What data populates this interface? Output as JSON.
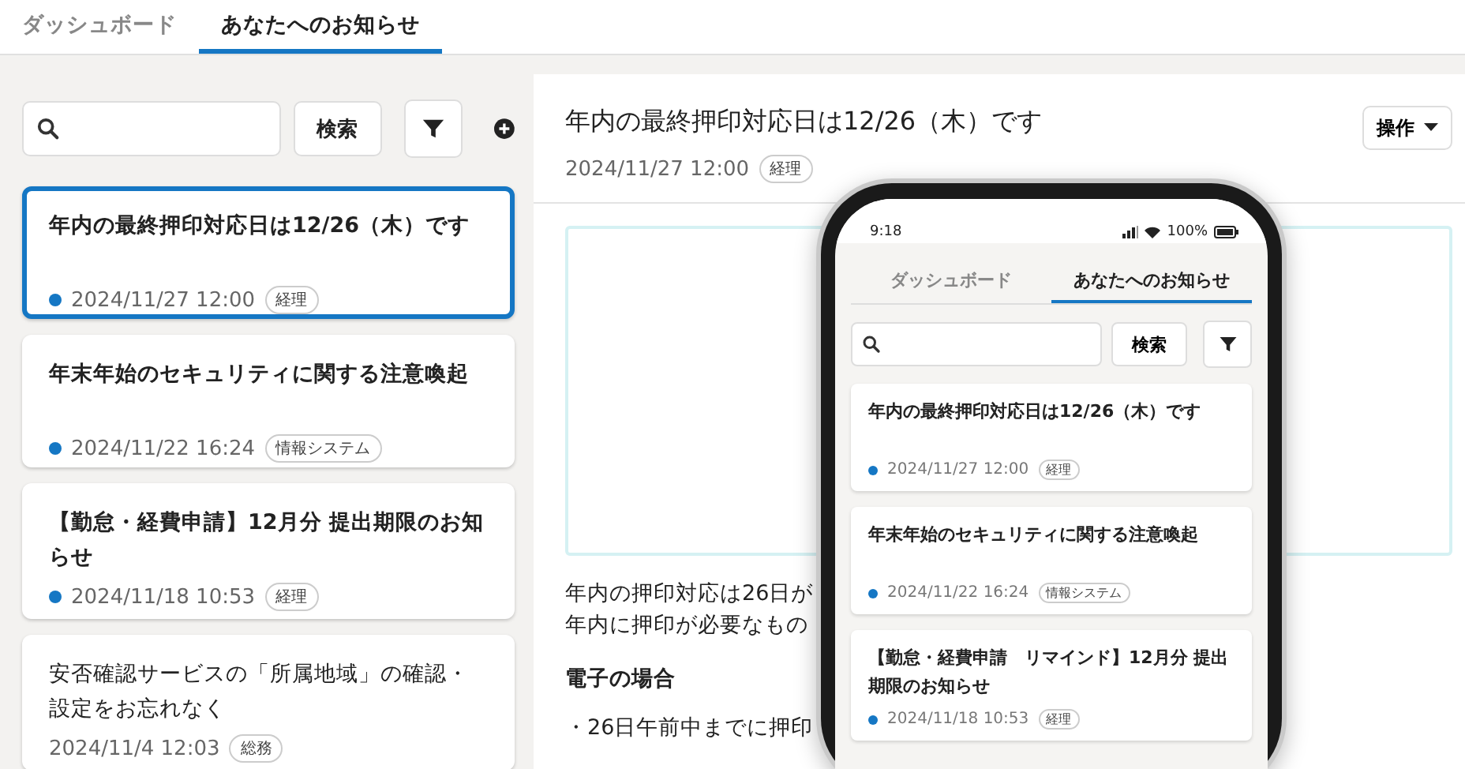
{
  "tabs": [
    {
      "label": "ダッシュボード",
      "selected": false
    },
    {
      "label": "あなたへのお知らせ",
      "selected": true
    }
  ],
  "sidebar": {
    "search": {
      "button": "検索"
    },
    "notices": [
      {
        "title": "年内の最終押印対応日は12/26（木）です",
        "date": "2024/11/27 12:00",
        "tag": "経理",
        "unread": true,
        "selected": true
      },
      {
        "title": "年末年始のセキュリティに関する注意喚起",
        "date": "2024/11/22 16:24",
        "tag": "情報システム",
        "unread": true,
        "selected": false
      },
      {
        "title": "【勤怠・経費申請】12月分 提出期限のお知らせ",
        "date": "2024/11/18 10:53",
        "tag": "経理",
        "unread": true,
        "selected": false
      },
      {
        "title": "安否確認サービスの「所属地域」の確認・設定をお忘れなく",
        "date": "2024/11/4 12:03",
        "tag": "総務",
        "unread": false,
        "selected": false
      }
    ]
  },
  "detail": {
    "title": "年内の最終押印対応日は12/26（木）です",
    "date": "2024/11/27 12:00",
    "tag": "経理",
    "action_button": "操作",
    "paragraphs": [
      "年内の押印対応は26日が",
      "年内に押印が必要なもの"
    ],
    "heading": "電子の場合",
    "bullet": "・26日午前中までに押印"
  },
  "phone": {
    "status_bar": {
      "time": "9:18",
      "battery": "100%"
    },
    "tabs": [
      {
        "label": "ダッシュボード",
        "selected": false
      },
      {
        "label": "あなたへのお知らせ",
        "selected": true
      }
    ],
    "search": {
      "button": "検索"
    },
    "notices": [
      {
        "title": "年内の最終押印対応日は12/26（木）です",
        "date": "2024/11/27 12:00",
        "tag": "経理",
        "unread": true
      },
      {
        "title": "年末年始のセキュリティに関する注意喚起",
        "date": "2024/11/22 16:24",
        "tag": "情報システム",
        "unread": true
      },
      {
        "title": "【勤怠・経費申請　リマインド】12月分 提出期限のお知らせ",
        "date": "2024/11/18 10:53",
        "tag": "経理",
        "unread": true
      }
    ]
  }
}
